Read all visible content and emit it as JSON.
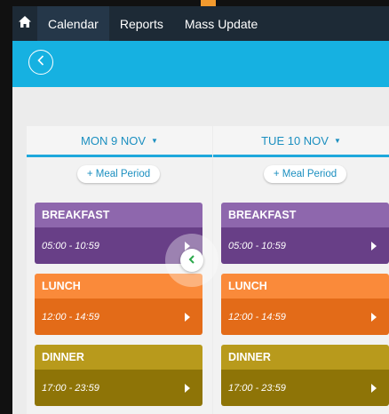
{
  "nav": {
    "home_icon": "home-icon",
    "items": [
      {
        "label": "Calendar",
        "active": true
      },
      {
        "label": "Reports",
        "active": false
      },
      {
        "label": "Mass Update",
        "active": false
      }
    ]
  },
  "subbar": {
    "back_icon": "chevron-left-circle-icon"
  },
  "columns": [
    {
      "header": "MON 9 NOV",
      "add_button": "+ Meal Period",
      "meals": [
        {
          "name": "BREAKFAST",
          "time": "05:00 - 10:59"
        },
        {
          "name": "LUNCH",
          "time": "12:00 - 14:59"
        },
        {
          "name": "DINNER",
          "time": "17:00 - 23:59"
        }
      ]
    },
    {
      "header": "TUE 10 NOV",
      "add_button": "+ Meal Period",
      "meals": [
        {
          "name": "BREAKFAST",
          "time": "05:00 - 10:59"
        },
        {
          "name": "LUNCH",
          "time": "12:00 - 14:59"
        },
        {
          "name": "DINNER",
          "time": "17:00 - 23:59"
        }
      ]
    }
  ],
  "colors": {
    "nav_bg": "#1d2a36",
    "subbar_bg": "#16b1e1",
    "accent": "#1b8fc0",
    "breakfast_title": "#8e67ad",
    "breakfast_body": "#683f87",
    "lunch_title": "#fa8a3a",
    "lunch_body": "#e36b18",
    "dinner_title": "#b89a1c",
    "dinner_body": "#8e7407"
  }
}
